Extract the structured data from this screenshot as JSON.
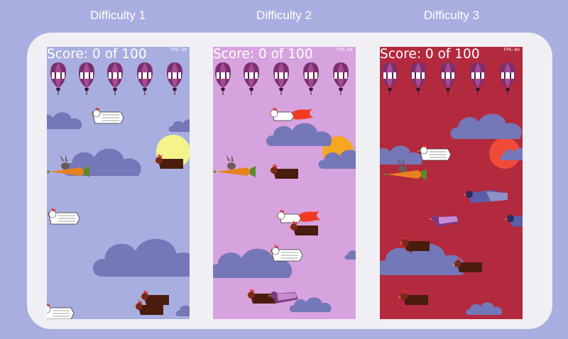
{
  "levels": [
    {
      "heading": "Difficulty 1",
      "score_text": "Score: 0 of 100",
      "fps_text": "FPS: 59",
      "sky_color": "#a9aee0",
      "sun_color": "#f4f48a",
      "cloud_color": "#7478b8",
      "balloon_count": 5,
      "sprites": [
        "clouds",
        "sun",
        "balloons",
        "chicken-white",
        "chicken-brown",
        "rabbit-carrot-plane"
      ]
    },
    {
      "heading": "Difficulty 2",
      "score_text": "Score: 0 of 100",
      "fps_text": "FPS: 64",
      "sky_color": "#d7a3df",
      "sun_color": "#f6a623",
      "cloud_color": "#7478b8",
      "balloon_count": 5,
      "sprites": [
        "clouds",
        "sun",
        "balloons",
        "rocket-chicken",
        "chicken-brown",
        "chicken-purple",
        "rabbit-carrot-plane"
      ]
    },
    {
      "heading": "Difficulty 3",
      "score_text": "Score: 0 of 100",
      "fps_text": "FPS: 60",
      "sky_color": "#b3293d",
      "sun_color": "#f04a38",
      "cloud_color": "#7478b8",
      "balloon_count": 5,
      "sprites": [
        "clouds",
        "sun",
        "balloons",
        "chicken-white",
        "chicken-brown",
        "chicken-purple",
        "chicken-blue-speckled",
        "rabbit-carrot-plane"
      ]
    }
  ],
  "colors": {
    "page_bg": "#a9aee0",
    "frame_bg": "#f0f0f4",
    "balloon": "#7b2f6e",
    "text": "#ffffff"
  }
}
